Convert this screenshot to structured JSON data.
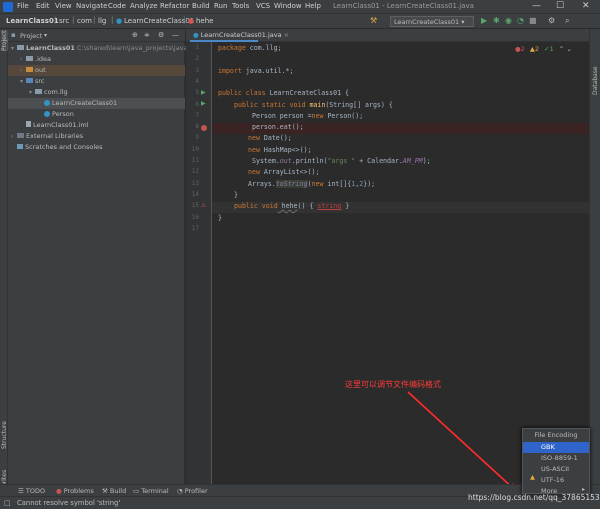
{
  "menu": [
    "File",
    "Edit",
    "View",
    "Navigate",
    "Code",
    "Analyze",
    "Refactor",
    "Build",
    "Run",
    "Tools",
    "VCS",
    "Window",
    "Help"
  ],
  "window_title": "LearnClass01 - LearnCreateClass01.java",
  "window_controls": {
    "minimize": "—",
    "maximize": "☐",
    "close": "✕"
  },
  "breadcrumbs": [
    "LearnClass01",
    "src",
    "com",
    "llg",
    "LearnCreateClass01",
    "hehe"
  ],
  "run_config": "LearnCreateClass01",
  "project_panel": {
    "title": "Project",
    "tree": [
      {
        "label": "LearnClass01",
        "path": "C:\\shared\\learn\\java_projects\\java",
        "icon": "folder"
      },
      {
        "label": ".idea",
        "icon": "folder"
      },
      {
        "label": "out",
        "icon": "folder-orange"
      },
      {
        "label": "src",
        "icon": "folder-blue"
      },
      {
        "label": "com.llg",
        "icon": "package"
      },
      {
        "label": "LearnCreateClass01",
        "icon": "class"
      },
      {
        "label": "Person",
        "icon": "class"
      },
      {
        "label": "LearnClass01.iml",
        "icon": "file"
      },
      {
        "label": "External Libraries",
        "icon": "library"
      },
      {
        "label": "Scratches and Consoles",
        "icon": "scratch"
      }
    ]
  },
  "editor_tab": "LearnCreateClass01.java",
  "line_numbers": [
    "1",
    "2",
    "3",
    "4",
    "5",
    "6",
    "7",
    "8",
    "9",
    "10",
    "11",
    "12",
    "13",
    "14",
    "15",
    "16",
    "17"
  ],
  "code": {
    "l1_kw": "package",
    "l1_rest": " com.llg;",
    "l3_kw": "import",
    "l3_rest": " java.util.*;",
    "l5_kw": "public class",
    "l5_rest": " LearnCreateClass01 {",
    "l6_kw": "public static void",
    "l6_fn": " main",
    "l6_rest": "(String[] args) {",
    "l7_a": "Person person =",
    "l7_kw": "new",
    "l7_b": " Person();",
    "l8": "person.eat();",
    "l9_kw": "new",
    "l9_rest": " Date();",
    "l10_kw": "new",
    "l10_rest": " HashMap<>();",
    "l11_a": "System.",
    "l11_it": "out",
    "l11_b": ".println(",
    "l11_str": "\"args \"",
    "l11_c": " + Calendar.",
    "l11_it2": "AM_PM",
    "l11_d": ");",
    "l12_kw": "new",
    "l12_rest": " ArrayList<>();",
    "l13_a": "Arrays.",
    "l13_it": "toString",
    "l13_b": "(",
    "l13_kw": "new",
    "l13_c": " int[]{",
    "l13_n1": "1",
    "l13_d": ",",
    "l13_n2": "2",
    "l13_e": "});",
    "l14": "}",
    "l15_kw": "public void",
    "l15_fn": " hehe",
    "l15_a": "() { ",
    "l15_err": "string",
    "l15_b": " }",
    "l16": "}"
  },
  "inspections": {
    "errors": "2",
    "warnings": "2",
    "typos": "1"
  },
  "left_stripe": [
    "Project",
    "Structure",
    "Favorites"
  ],
  "right_stripe": [
    "Database"
  ],
  "bottom_tools": [
    "TODO",
    "Problems",
    "Build",
    "Terminal",
    "Profiler"
  ],
  "status_message": "Cannot resolve symbol 'string'",
  "annotation": "这里可以调节文件编码格式",
  "encoding_popup": {
    "title": "File Encoding",
    "items": [
      "GBK",
      "ISO-8859-1",
      "US-ASCII",
      "UTF-16",
      "More"
    ],
    "selected": "GBK"
  },
  "watermark": "https://blog.csdn.net/qq_37865153",
  "colors": {
    "keyword": "#cc7832",
    "function": "#ffc66d",
    "string": "#6a8759",
    "annotation": "#ff3b3b",
    "selection": "#2f65ca"
  }
}
